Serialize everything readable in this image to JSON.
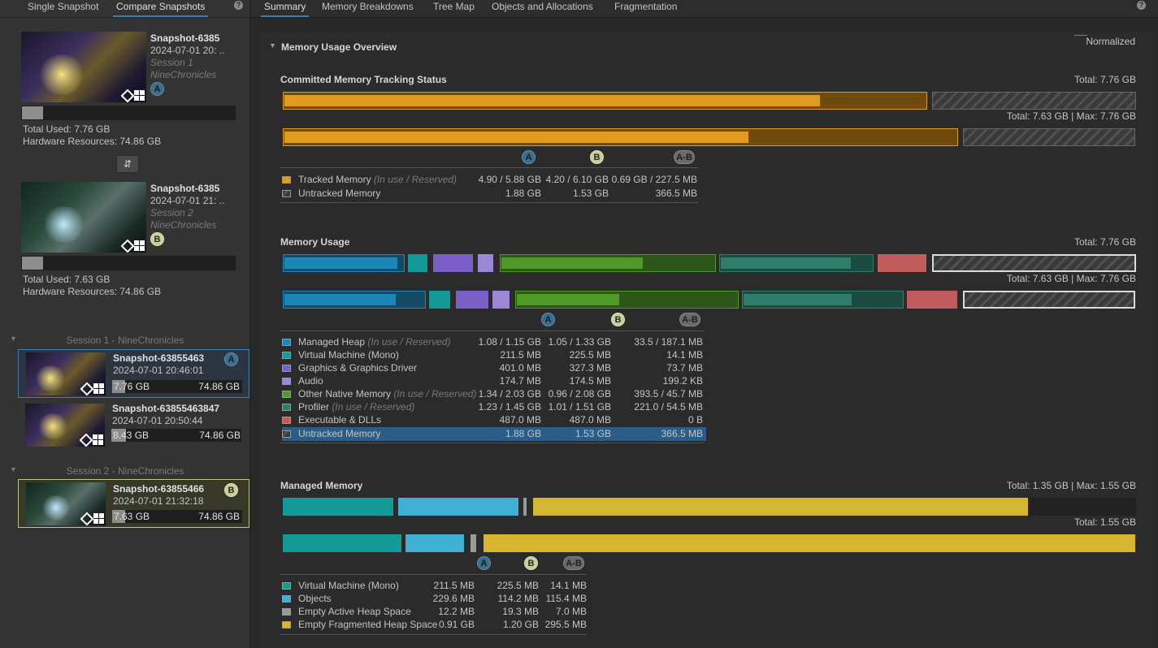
{
  "left_tabs": [
    "Single Snapshot",
    "Compare Snapshots"
  ],
  "snapshot_a": {
    "name": "Snapshot-6385",
    "date": "2024-07-01 20: ..",
    "session": "Session 1",
    "product": "NineChronicles",
    "badge": "A",
    "total_used": "Total Used: 7.76 GB",
    "hardware": "Hardware Resources: 74.86 GB",
    "used_fraction": 0.1
  },
  "snapshot_b": {
    "name": "Snapshot-6385",
    "date": "2024-07-01 21: ..",
    "session": "Session 2",
    "product": "NineChronicles",
    "badge": "B",
    "total_used": "Total Used: 7.63 GB",
    "hardware": "Hardware Resources: 74.86 GB",
    "used_fraction": 0.1
  },
  "swap_icon": "⇵",
  "sessions": [
    {
      "title": "Session 1 - NineChronicles",
      "items": [
        {
          "name": "Snapshot-63855463",
          "date": "2024-07-01 20:46:01",
          "used": "7.76 GB",
          "total": "74.86 GB",
          "badge": "A",
          "used_fraction": 0.1
        },
        {
          "name": "Snapshot-63855463847",
          "date": "2024-07-01 20:50:44",
          "used": "8.43 GB",
          "total": "74.86 GB",
          "badge": "",
          "used_fraction": 0.11
        }
      ]
    },
    {
      "title": "Session 2 - NineChronicles",
      "items": [
        {
          "name": "Snapshot-63855466",
          "date": "2024-07-01 21:32:18",
          "used": "7.63 GB",
          "total": "74.86 GB",
          "badge": "B",
          "used_fraction": 0.1
        }
      ]
    }
  ],
  "right_tabs": [
    "Summary",
    "Memory Breakdowns",
    "Tree Map",
    "Objects and Allocations",
    "Fragmentation"
  ],
  "overview_title": "Memory Usage Overview",
  "normalized_label": "Normalized",
  "badges": {
    "a": "A",
    "b": "B",
    "ab": "A-B"
  },
  "committed": {
    "title": "Committed Memory Tracking Status",
    "total_a": "Total: 7.76 GB",
    "total_b": "Total: 7.63 GB",
    "max_b": "Max: 7.76 GB",
    "rows": [
      {
        "label": "Tracked Memory",
        "note": "(In use / Reserved)",
        "a": "4.90 / 5.88 GB",
        "b": "4.20 / 6.10 GB",
        "ab": "0.69 GB / 227.5 MB",
        "color": "#e09a1e"
      },
      {
        "label": "Untracked Memory",
        "note": "",
        "a": "1.88 GB",
        "b": "1.53 GB",
        "ab": "366.5 MB",
        "color": "hatch"
      }
    ]
  },
  "usage": {
    "title": "Memory Usage",
    "total_a": "Total: 7.76 GB",
    "total_b": "Total: 7.63 GB",
    "max_b": "Max: 7.76 GB",
    "rows": [
      {
        "label": "Managed Heap",
        "note": "(In use / Reserved)",
        "a": "1.08 / 1.15 GB",
        "b": "1.05 / 1.33 GB",
        "ab": "33.5 / 187.1 MB",
        "color": "#1b86b8"
      },
      {
        "label": "Virtual Machine (Mono)",
        "note": "",
        "a": "211.5 MB",
        "b": "225.5 MB",
        "ab": "14.1 MB",
        "color": "#149a96"
      },
      {
        "label": "Graphics & Graphics Driver",
        "note": "",
        "a": "401.0 MB",
        "b": "327.3 MB",
        "ab": "73.7 MB",
        "color": "#7a5fc6"
      },
      {
        "label": "Audio",
        "note": "",
        "a": "174.7 MB",
        "b": "174.5 MB",
        "ab": "199.2 KB",
        "color": "#9b87d6"
      },
      {
        "label": "Other Native Memory",
        "note": "(In use / Reserved)",
        "a": "1.34 / 2.03 GB",
        "b": "0.96 / 2.08 GB",
        "ab": "393.5 / 45.7 MB",
        "color": "#4f9a26"
      },
      {
        "label": "Profiler",
        "note": "(In use / Reserved)",
        "a": "1.23 / 1.45 GB",
        "b": "1.01 / 1.51 GB",
        "ab": "221.0 / 54.5 MB",
        "color": "#2e7d6a"
      },
      {
        "label": "Executable & DLLs",
        "note": "",
        "a": "487.0 MB",
        "b": "487.0 MB",
        "ab": "0 B",
        "color": "#c05c5c"
      },
      {
        "label": "Untracked Memory",
        "note": "",
        "a": "1.88 GB",
        "b": "1.53 GB",
        "ab": "366.5 MB",
        "color": "hatch"
      }
    ]
  },
  "managed": {
    "title": "Managed Memory",
    "total_a": "Total: 1.35 GB",
    "max_a": "Max: 1.55 GB",
    "total_b": "Total: 1.55 GB",
    "rows": [
      {
        "label": "Virtual Machine (Mono)",
        "a": "211.5 MB",
        "b": "225.5 MB",
        "ab": "14.1 MB",
        "color": "#149a96"
      },
      {
        "label": "Objects",
        "a": "229.6 MB",
        "b": "114.2 MB",
        "ab": "115.4 MB",
        "color": "#3fb0d4"
      },
      {
        "label": "Empty Active Heap Space",
        "a": "12.2 MB",
        "b": "19.3 MB",
        "ab": "7.0 MB",
        "color": "#9a9a9a"
      },
      {
        "label": "Empty Fragmented Heap Space",
        "a": "0.91 GB",
        "b": "1.20 GB",
        "ab": "295.5 MB",
        "color": "#d6b531"
      }
    ]
  }
}
